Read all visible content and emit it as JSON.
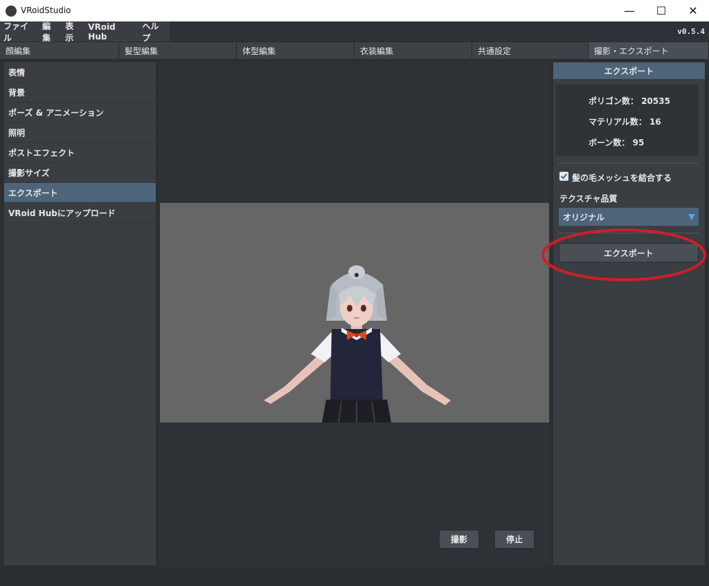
{
  "window": {
    "title": "VRoidStudio",
    "minimize_glyph": "—",
    "maximize_glyph": "☐",
    "close_glyph": "✕"
  },
  "menubar": {
    "items": [
      "ファイル",
      "編集",
      "表示",
      "VRoid Hub",
      "ヘルプ"
    ],
    "version": "v0.5.4"
  },
  "tabs": [
    "顔編集",
    "髪型編集",
    "体型編集",
    "衣装編集",
    "共通設定",
    "撮影・エクスポート"
  ],
  "left_menu": [
    "表情",
    "背景",
    "ポーズ & アニメーション",
    "照明",
    "ポストエフェクト",
    "撮影サイズ",
    "エクスポート",
    "VRoid Hubにアップロード"
  ],
  "viewport": {
    "capture_label": "撮影",
    "stop_label": "停止"
  },
  "export_panel": {
    "header": "エクスポート",
    "polygon_label": "ポリゴン数：",
    "polygon_value": "20535",
    "material_label": "マテリアル数：",
    "material_value": "16",
    "bone_label": "ボーン数：",
    "bone_value": "95",
    "merge_hair_label": "髪の毛メッシュを結合する",
    "texture_quality_label": "テクスチャ品質",
    "texture_quality_value": "オリジナル",
    "export_button": "エクスポート"
  },
  "colors": {
    "accent": "#4d6479",
    "annotation": "#cc1f2a",
    "dropdown_arrow": "#4fa8e8"
  }
}
